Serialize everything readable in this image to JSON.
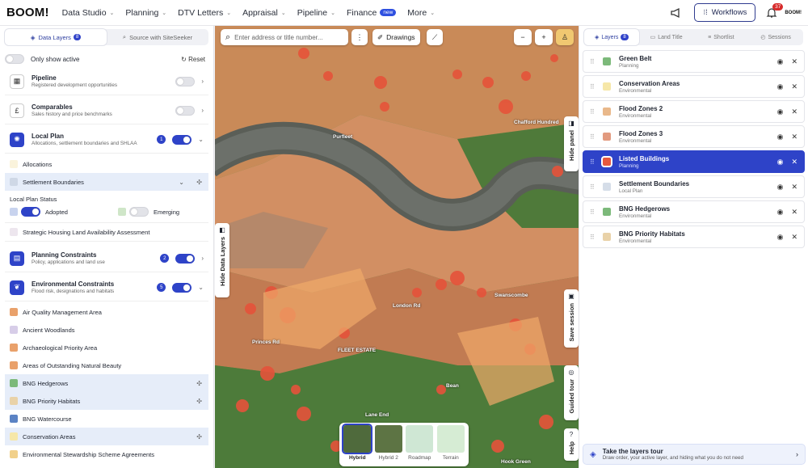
{
  "brand": "BOOM!",
  "nav": [
    {
      "label": "Data Studio",
      "chev": true
    },
    {
      "label": "Planning",
      "chev": true
    },
    {
      "label": "DTV Letters",
      "chev": true
    },
    {
      "label": "Appraisal",
      "chev": true
    },
    {
      "label": "Pipeline",
      "chev": true
    },
    {
      "label": "Finance",
      "badge": "new"
    },
    {
      "label": "More",
      "chev": true
    }
  ],
  "header": {
    "workflows_label": "Workflows",
    "notifications": "37",
    "mini_logo": "BOOM!"
  },
  "left": {
    "tabs": [
      {
        "label": "Data Layers",
        "count": "8"
      },
      {
        "label": "Source with SiteSeeker"
      }
    ],
    "only_active": "Only show active",
    "reset": "Reset",
    "pipeline": {
      "title": "Pipeline",
      "sub": "Registered development opportunities"
    },
    "comparables": {
      "title": "Comparables",
      "sub": "Sales history and price benchmarks"
    },
    "local_plan": {
      "title": "Local Plan",
      "sub": "Allocations, settlement boundaries and SHLAA",
      "count": "1"
    },
    "allocations": "Allocations",
    "settlement": "Settlement Boundaries",
    "lps_title": "Local Plan Status",
    "adopted": "Adopted",
    "emerging": "Emerging",
    "shlaa": "Strategic Housing Land Availability Assessment",
    "planning": {
      "title": "Planning Constraints",
      "sub": "Policy, applications and land use",
      "count": "2"
    },
    "environmental": {
      "title": "Environmental Constraints",
      "sub": "Flood risk, designations and habitats",
      "count": "5"
    },
    "env_items": [
      {
        "label": "Air Quality Management Area",
        "color": "#e9a16b"
      },
      {
        "label": "Ancient Woodlands",
        "color": "#d7cde8"
      },
      {
        "label": "Archaeological Priority Area",
        "color": "#e9a16b"
      },
      {
        "label": "Areas of Outstanding Natural Beauty",
        "color": "#e9a16b"
      },
      {
        "label": "BNG Hedgerows",
        "color": "#7cb97a",
        "hl": true
      },
      {
        "label": "BNG Priority Habitats",
        "color": "#e9d2a8",
        "hl": true
      },
      {
        "label": "BNG Watercourse",
        "color": "#5b83c4"
      },
      {
        "label": "Conservation Areas",
        "color": "#f6e7a8",
        "hl": true
      },
      {
        "label": "Environmental Stewardship Scheme Agreements",
        "color": "#f1d08a"
      }
    ]
  },
  "map": {
    "search_placeholder": "Enter address or title number...",
    "drawings": "Drawings",
    "hide_panel": "Hide panel",
    "hide_layers": "Hide Data Layers",
    "save_session": "Save session",
    "guided_tour": "Guided tour",
    "help": "Help",
    "labels": [
      "Purfleet",
      "Chafford Hundred",
      "FLEET ESTATE",
      "Swanscombe",
      "Bean",
      "Hook Green",
      "Lane End",
      "London Rd",
      "Princes Rd"
    ],
    "basemaps": [
      {
        "label": "Hybrid",
        "sel": true
      },
      {
        "label": "Hybrid 2"
      },
      {
        "label": "Roadmap"
      },
      {
        "label": "Terrain"
      }
    ]
  },
  "right": {
    "tabs": [
      {
        "label": "Layers",
        "count": "8"
      },
      {
        "label": "Land Title"
      },
      {
        "label": "Shortlist"
      },
      {
        "label": "Sessions"
      }
    ],
    "layers": [
      {
        "title": "Green Belt",
        "sub": "Planning",
        "color": "#7cb97a"
      },
      {
        "title": "Conservation Areas",
        "sub": "Environmental",
        "color": "#f6e7a8"
      },
      {
        "title": "Flood Zones 2",
        "sub": "Environmental",
        "color": "#e9b88a"
      },
      {
        "title": "Flood Zones 3",
        "sub": "Environmental",
        "color": "#e29a7f"
      },
      {
        "title": "Listed Buildings",
        "sub": "Planning",
        "color": "#e8583e",
        "selected": true
      },
      {
        "title": "Settlement Boundaries",
        "sub": "Local Plan",
        "color": "#d5dde8"
      },
      {
        "title": "BNG Hedgerows",
        "sub": "Environmental",
        "color": "#7cb97a"
      },
      {
        "title": "BNG Priority Habitats",
        "sub": "Environmental",
        "color": "#e9d2a8"
      }
    ],
    "tour_title": "Take the layers tour",
    "tour_sub": "Draw order, your active layer, and hiding what you do not need"
  }
}
